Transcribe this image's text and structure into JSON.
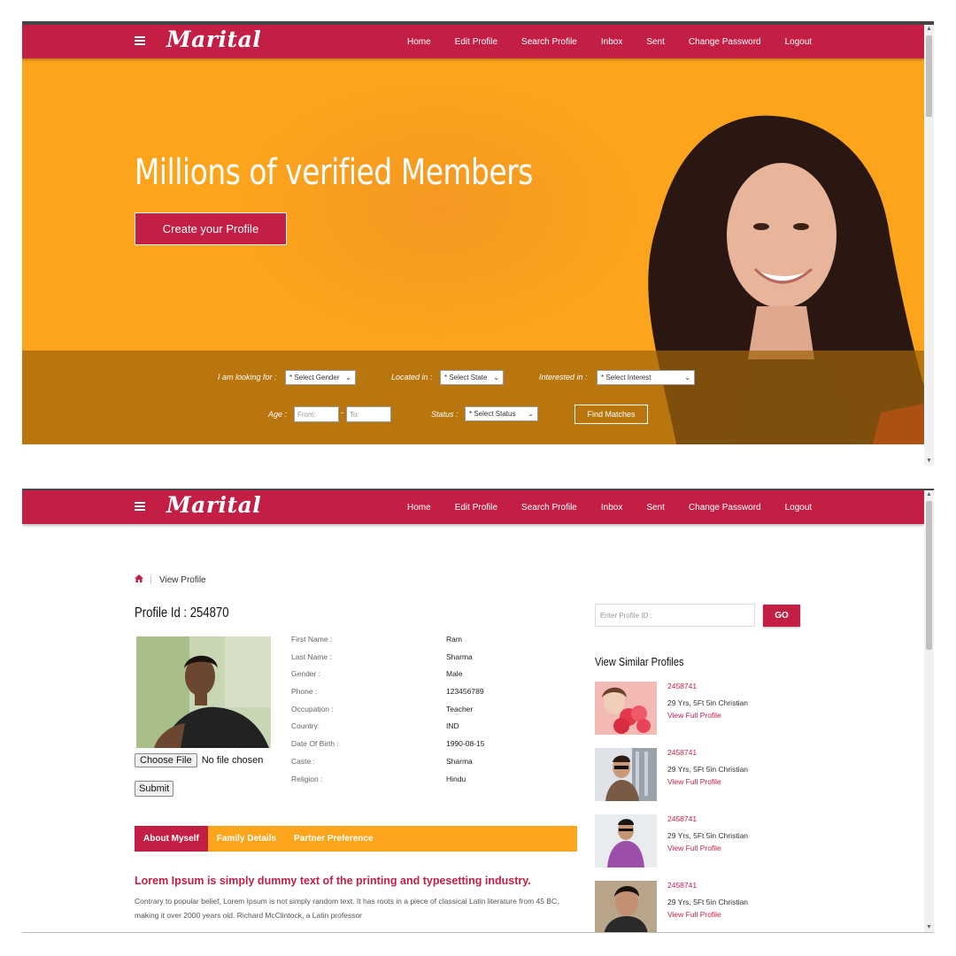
{
  "brand": {
    "logo": "Marital",
    "accent": "#c31f45",
    "orange": "#fca51c"
  },
  "nav": {
    "items": [
      {
        "label": "Home"
      },
      {
        "label": "Edit Profile"
      },
      {
        "label": "Search Profile"
      },
      {
        "label": "Inbox"
      },
      {
        "label": "Sent"
      },
      {
        "label": "Change Password"
      },
      {
        "label": "Logout"
      }
    ]
  },
  "hero": {
    "title": "Millions of verified Members",
    "cta_label": "Create your Profile"
  },
  "search": {
    "looking_for_label": "I am looking for :",
    "gender_value": "* Select Gender",
    "located_label": "Located in :",
    "state_value": "* Select State",
    "interested_label": "Interested in :",
    "interest_value": "* Select Interest",
    "age_label": "Age :",
    "age_from_placeholder": "From:",
    "age_separator": "-",
    "age_to_placeholder": "To:",
    "status_label": "Status :",
    "status_value": "* Select Status",
    "find_label": "Find Matches"
  },
  "breadcrumb": {
    "home_icon": "home-icon",
    "current": "View Profile"
  },
  "profile": {
    "id_label": "Profile Id : 254870",
    "choose_file_label": "Choose File",
    "no_file_text": "No file chosen",
    "submit_label": "Submit",
    "fields": [
      {
        "label": "First Name :",
        "value": "Ram"
      },
      {
        "label": "Last Name :",
        "value": "Sharma"
      },
      {
        "label": "Gender :",
        "value": "Male"
      },
      {
        "label": "Phone :",
        "value": "123456789"
      },
      {
        "label": "Occupation :",
        "value": "Teacher"
      },
      {
        "label": "Country:",
        "value": "IND"
      },
      {
        "label": "Date Of Birth :",
        "value": "1990-08-15"
      },
      {
        "label": "Caste :",
        "value": "Sharma"
      },
      {
        "label": "Religion :",
        "value": "Hindu"
      }
    ]
  },
  "tabs": [
    {
      "label": "About Myself",
      "active": true
    },
    {
      "label": "Family Details",
      "active": false
    },
    {
      "label": "Partner Preference",
      "active": false
    }
  ],
  "about": {
    "title": "Lorem Ipsum is simply dummy text of the printing and typesetting industry.",
    "text": "Contrary to popular belief, Lorem Ipsum is not simply random text. It has roots in a piece of classical Latin literature from 45 BC, making it over 2000 years old. Richard McClintock, a Latin professor"
  },
  "sidebar": {
    "profile_id_placeholder": "Enter Profile ID :",
    "go_label": "GO",
    "similar_title": "View Similar Profiles",
    "similar": [
      {
        "id": "2458741",
        "info": "29 Yrs, 5Ft 5in Christian",
        "link": "View Full Profile"
      },
      {
        "id": "2458741",
        "info": "29 Yrs, 5Ft 5in Christian",
        "link": "View Full Profile"
      },
      {
        "id": "2458741",
        "info": "29 Yrs, 5Ft 5in Christian",
        "link": "View Full Profile"
      },
      {
        "id": "2458741",
        "info": "29 Yrs, 5Ft 5in Christian",
        "link": "View Full Profile"
      }
    ]
  }
}
